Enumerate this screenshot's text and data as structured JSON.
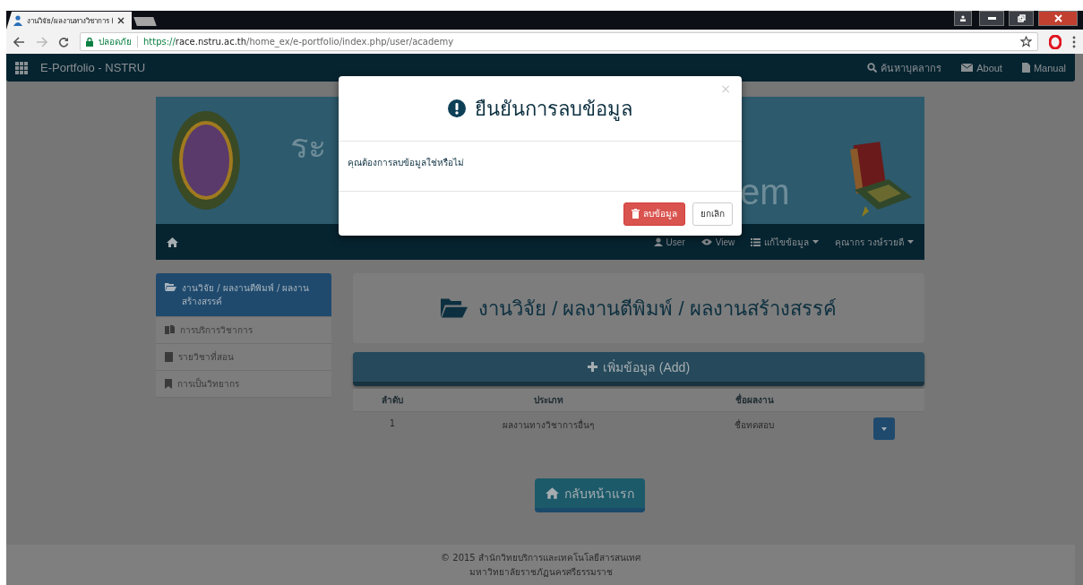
{
  "browser": {
    "tab_title": "งานวิจัย/ผลงานทางวิชาการ (",
    "secure_label": "ปลอดภัย",
    "url_scheme": "https://",
    "url_host": "race.nstru.ac.th",
    "url_path": "/home_ex/e-portfolio/index.php/user/academy"
  },
  "navbar": {
    "brand": "E-Portfolio  -  NSTRU",
    "links": [
      {
        "kind": "search",
        "label": "ค้นหาบุคลากร"
      },
      {
        "kind": "mail",
        "label": "About"
      },
      {
        "kind": "file",
        "label": "Manual"
      }
    ]
  },
  "banner": {
    "title_start": "ระ",
    "title_end": "em"
  },
  "subnav": {
    "links": [
      {
        "kind": "user",
        "label": "User",
        "dropdown": false
      },
      {
        "kind": "eye",
        "label": "View",
        "dropdown": false
      },
      {
        "kind": "list",
        "label": "แก้ไขข้อมูล",
        "dropdown": true
      },
      {
        "kind": "none",
        "label": "คุณากร วงษ์รวยดี",
        "dropdown": true
      }
    ]
  },
  "sidebar": {
    "items": [
      {
        "kind": "folder",
        "label": "งานวิจัย / ผลงานตีพิมพ์ / ผลงานสร้างสรรค์",
        "selected": true
      },
      {
        "kind": "files",
        "label": "การบริการวิชาการ",
        "selected": false
      },
      {
        "kind": "book",
        "label": "รายวิชาที่สอน",
        "selected": false
      },
      {
        "kind": "bookmark",
        "label": "การเป็นวิทยากร",
        "selected": false
      }
    ]
  },
  "content": {
    "heading": "งานวิจัย / ผลงานตีพิมพ์ / ผลงานสร้างสรรค์",
    "add_button": "เพิ่มข้อมูล (Add)",
    "table": {
      "columns": [
        "ลำดับ",
        "ประเภท",
        "ชื่อผลงาน"
      ],
      "rows": [
        {
          "cells": [
            "1",
            "ผลงานทางวิชาการอื่นๆ",
            "ชื่อทดสอบ"
          ]
        }
      ]
    },
    "home_button": "กลับหน้าแรก"
  },
  "footer": {
    "lines": [
      "© 2015 สำนักวิทยบริการและเทคโนโลยีสารสนเทศ",
      "มหาวิทยาลัยราชภัฏนครศรีธรรมราช"
    ]
  },
  "modal": {
    "title": "ยืนยันการลบข้อมูล",
    "close": "×",
    "message": "คุณต้องการลบข้อมูลใช่หรือไม่",
    "buttons": [
      {
        "kind": "danger",
        "label": "ลบข้อมูล"
      },
      {
        "kind": "default",
        "label": "ยกเลิก"
      }
    ]
  }
}
